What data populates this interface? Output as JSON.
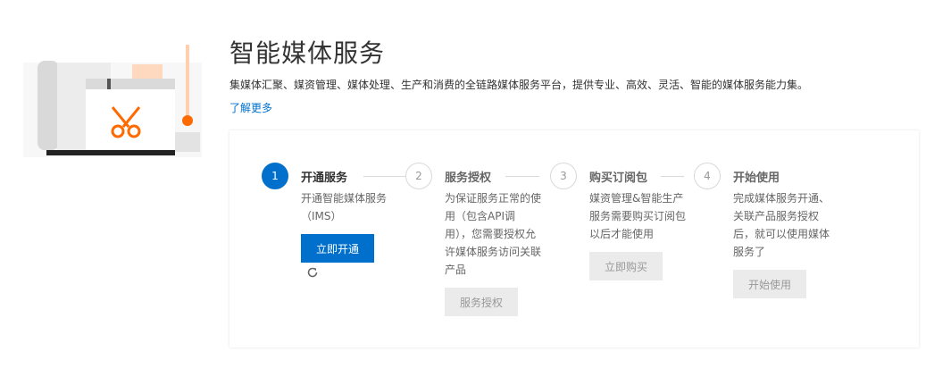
{
  "header": {
    "title": "智能媒体服务",
    "description": "集媒体汇聚、媒资管理、媒体处理、生产和消费的全链路媒体服务平台，提供专业、高效、灵活、智能的媒体服务能力集。",
    "learn_more": "了解更多"
  },
  "illustration": {
    "icon": "scissors-icon",
    "accent_color": "#ff6a00"
  },
  "steps": [
    {
      "number": "1",
      "title": "开通服务",
      "description": "开通智能媒体服务（IMS）",
      "button": "立即开通",
      "active": true,
      "refresh_icon": "refresh-icon"
    },
    {
      "number": "2",
      "title": "服务授权",
      "description": "为保证服务正常的使用（包含API调用），您需要授权允许媒体服务访问关联产品",
      "button": "服务授权",
      "active": false
    },
    {
      "number": "3",
      "title": "购买订阅包",
      "description": "媒资管理&智能生产服务需要购买订阅包以后才能使用",
      "button": "立即购买",
      "active": false
    },
    {
      "number": "4",
      "title": "开始使用",
      "description": "完成媒体服务开通、关联产品服务授权后，就可以使用媒体服务了",
      "button": "开始使用",
      "active": false
    }
  ],
  "colors": {
    "primary": "#0070cc",
    "disabled_bg": "#ebebeb",
    "disabled_text": "#999999"
  }
}
